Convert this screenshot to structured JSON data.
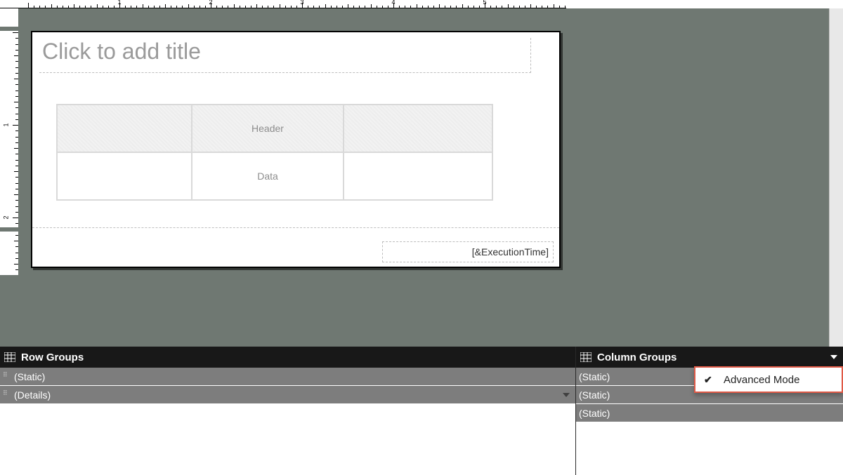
{
  "ruler": {
    "h_numbers": [
      1,
      2,
      3,
      4,
      5
    ],
    "v_numbers": [
      1,
      2
    ]
  },
  "report": {
    "title_placeholder": "Click to add title",
    "tablix_header_label": "Header",
    "tablix_data_label": "Data",
    "footer_expression": "[&ExecutionTime]"
  },
  "groups": {
    "row_title": "Row Groups",
    "column_title": "Column Groups",
    "row_items": [
      "(Static)",
      "(Details)"
    ],
    "column_items": [
      "(Static)",
      "(Static)",
      "(Static)"
    ]
  },
  "menu": {
    "advanced_mode_label": "Advanced Mode",
    "advanced_mode_checked": true
  }
}
